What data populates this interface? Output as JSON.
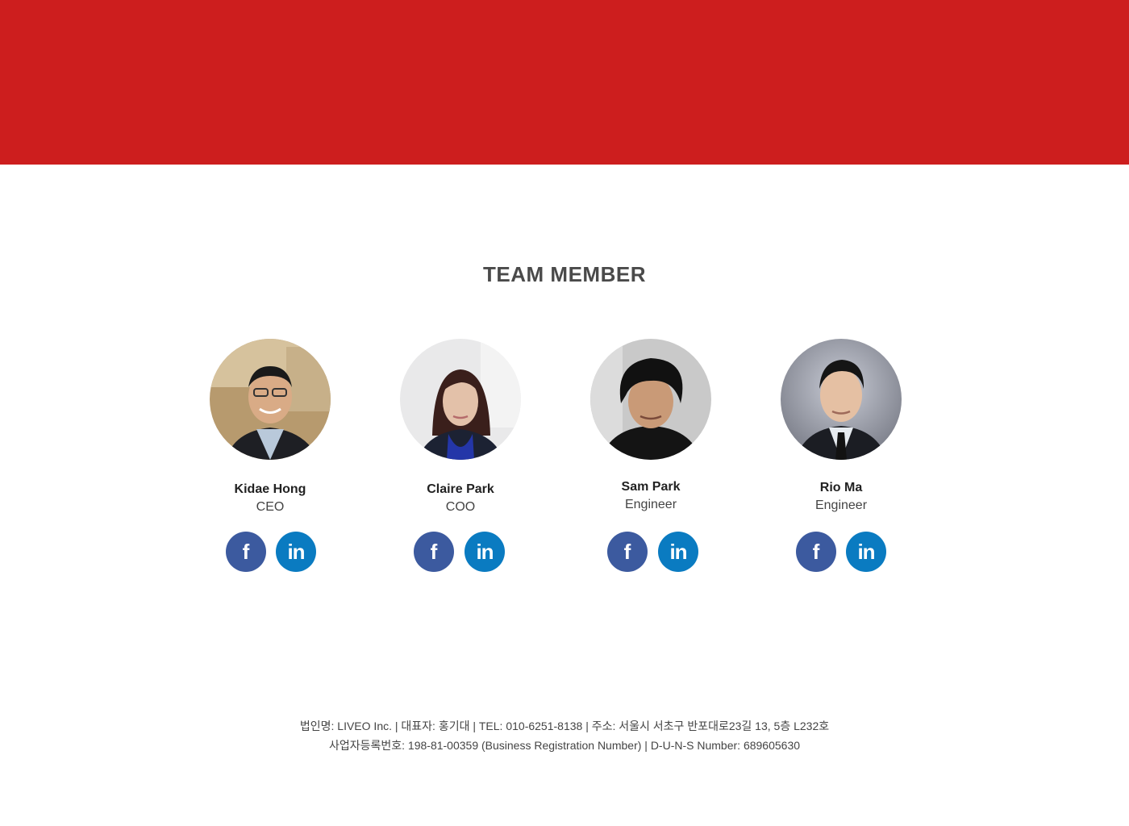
{
  "banner": {
    "color": "#cd1e1e"
  },
  "section": {
    "title": "TEAM MEMBER"
  },
  "team": [
    {
      "name": "Kidae Hong",
      "role": "CEO"
    },
    {
      "name": "Claire Park",
      "role": "COO"
    },
    {
      "name": "Sam Park",
      "role": "Engineer"
    },
    {
      "name": "Rio Ma",
      "role": "Engineer"
    }
  ],
  "social": {
    "facebook_icon": "facebook-icon",
    "linkedin_icon": "linkedin-icon",
    "facebook_glyph": "f",
    "linkedin_glyph": "in",
    "facebook_color": "#3c5a9f",
    "linkedin_color": "#0a7bc1"
  },
  "footer": {
    "line1": "법인명: LIVEO Inc. |  대표자: 홍기대  |  TEL: 010-6251-8138  |  주소: 서울시 서초구 반포대로23길 13, 5층 L232호",
    "line2": "사업자등록번호: 198-81-00359 (Business Registration Number)  |  D-U-N-S Number: 689605630"
  }
}
